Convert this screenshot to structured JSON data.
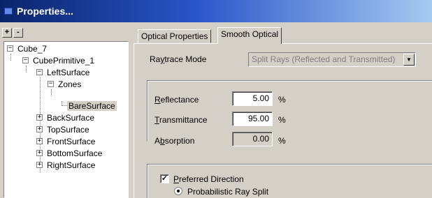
{
  "window": {
    "title": "Properties..."
  },
  "toolbar": {
    "expand_label": "+",
    "collapse_label": "-"
  },
  "tree": {
    "nodes": [
      {
        "label": "Cube_7",
        "expander": "−"
      },
      {
        "label": "CubePrimitive_1",
        "expander": "−"
      },
      {
        "label": "LeftSurface",
        "expander": "−"
      },
      {
        "label": "Zones",
        "expander": "−"
      },
      {
        "label": "BareSurface",
        "expander": ""
      },
      {
        "label": "BackSurface",
        "expander": "+"
      },
      {
        "label": "TopSurface",
        "expander": "+"
      },
      {
        "label": "FrontSurface",
        "expander": "+"
      },
      {
        "label": "BottomSurface",
        "expander": "+"
      },
      {
        "label": "RightSurface",
        "expander": "+"
      }
    ],
    "selected": "BareSurface"
  },
  "tabs": [
    {
      "label": "Optical Properties",
      "active": false
    },
    {
      "label": "Smooth Optical",
      "active": true
    }
  ],
  "raytrace": {
    "label_pre": "Ra",
    "label_u": "y",
    "label_post": "trace Mode",
    "value": "Split Rays (Reflected and Transmitted)"
  },
  "reflectance": {
    "label_u": "R",
    "label_post": "eflectance",
    "value": "5.00",
    "unit": "%"
  },
  "transmittance": {
    "label_u": "T",
    "label_post": "ransmittance",
    "value": "95.00",
    "unit": "%"
  },
  "absorption": {
    "label_pre": "A",
    "label_u": "b",
    "label_post": "sorption",
    "value": "0.00",
    "unit": "%"
  },
  "preferred": {
    "checked_glyph": "✓",
    "label_u": "P",
    "label_post": "referred Direction"
  },
  "ray_split": {
    "label": "Probabilistic Ray Split"
  }
}
